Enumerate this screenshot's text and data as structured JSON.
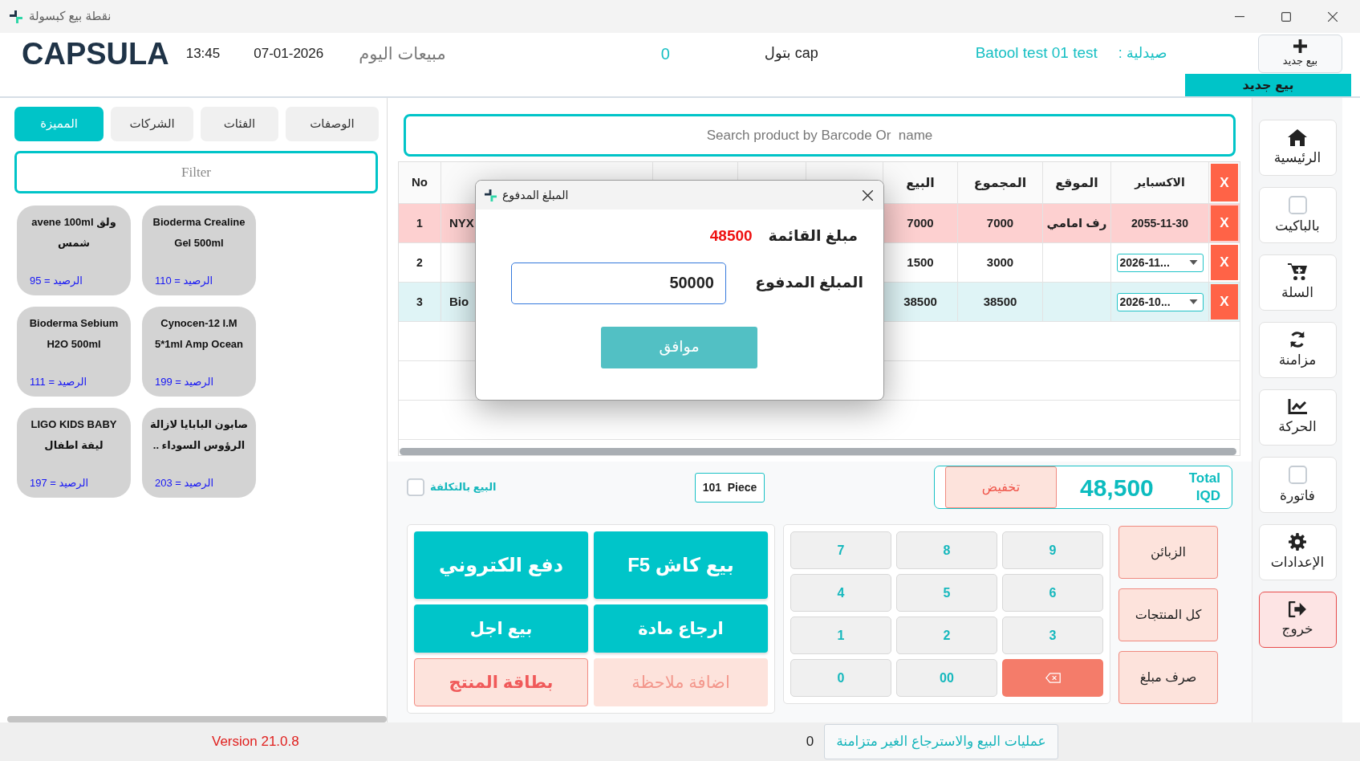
{
  "window": {
    "title": "نقطة بيع كبسولة"
  },
  "header": {
    "logo": "CAPSULA",
    "time": "13:45",
    "date": "07-01-2026",
    "sales_label": "مبيعات اليوم",
    "sales_count": "0",
    "user": "بتول cap",
    "pharmacy_name": "Batool test 01 test",
    "pharmacy_label": "صيدلية :",
    "new_sale_button": "بيع جديد",
    "sale_tab": {
      "label": "بيع جديد",
      "selected": true
    }
  },
  "left_panel": {
    "tabs": [
      {
        "label": "الوصفات",
        "selected": false
      },
      {
        "label": "الفئات",
        "selected": false
      },
      {
        "label": "الشركات",
        "selected": false
      },
      {
        "label": "المميزة",
        "selected": true
      }
    ],
    "filter": {
      "placeholder": "Filter"
    },
    "products": [
      {
        "name": "Bioderma Crealine Gel 500ml",
        "stock": "الرصيد = 110"
      },
      {
        "name": "avene 100ml ولق شمس",
        "stock": "الرصيد = 95"
      },
      {
        "name": "Cynocen-12 I.M 5*1ml Amp Ocean",
        "stock": "الرصيد = 199"
      },
      {
        "name": "Bioderma Sebium H2O 500ml",
        "stock": "الرصيد = 111"
      },
      {
        "name": "صابون البابايا لازالة الرؤوس السوداء ..",
        "stock": "الرصيد = 203"
      },
      {
        "name": "LIGO KIDS BABY ليفة اطفال",
        "stock": "الرصيد = 197"
      }
    ]
  },
  "search": {
    "placeholder": "Search product by Barcode Or  name"
  },
  "table": {
    "columns": {
      "no": "No",
      "sale": "البيع",
      "total": "المجموع",
      "location": "الموقع",
      "expiry": "الاكسباير",
      "delete": "X"
    },
    "rows": [
      {
        "no": "1",
        "name": "NYX",
        "sale": "7000",
        "total": "7000",
        "location": "رف امامي",
        "expiry": {
          "kind": "text",
          "value": "2055-11-30"
        },
        "delete": "X",
        "color": "#fdd0d0"
      },
      {
        "no": "2",
        "sale": "1500",
        "total": "3000",
        "expiry": {
          "kind": "dropdown",
          "value": "2026-11..."
        },
        "delete": "X",
        "color": "#ffffff"
      },
      {
        "no": "3",
        "name": "Bio",
        "sale": "38500",
        "total": "38500",
        "expiry": {
          "kind": "dropdown",
          "value": "2026-10..."
        },
        "delete": "X",
        "color": "#dff4f6"
      }
    ]
  },
  "dialog": {
    "title": "المبلغ المدفوع",
    "list_amount_label": "مبلغ القائمة",
    "list_amount": "48500",
    "paid_label": "المبلغ المدفوع",
    "paid_value": "50000",
    "ok_button": "موافق"
  },
  "cart_summary": {
    "sell_at_cost": {
      "label": "البيع بالتكلفة",
      "checked": false
    },
    "pieces": "101  Piece",
    "discount_button": "تخفيض",
    "amount": "48,500",
    "total_label": "Total",
    "currency": "IQD"
  },
  "actions": [
    {
      "label": "بيع كاش F5",
      "kind": "primary"
    },
    {
      "label": "دفع الكتروني",
      "kind": "primary"
    },
    {
      "label": "ارجاع مادة",
      "kind": "primary"
    },
    {
      "label": "بيع اجل",
      "kind": "primary"
    },
    {
      "label": "اضافة ملاحظة",
      "kind": "soft"
    },
    {
      "label": "بطاقة المنتج",
      "kind": "outline"
    }
  ],
  "keypad": [
    {
      "kind": "digit",
      "label": "9"
    },
    {
      "kind": "digit",
      "label": "8"
    },
    {
      "kind": "digit",
      "label": "7"
    },
    {
      "kind": "digit",
      "label": "6"
    },
    {
      "kind": "digit",
      "label": "5"
    },
    {
      "kind": "digit",
      "label": "4"
    },
    {
      "kind": "digit",
      "label": "3"
    },
    {
      "kind": "digit",
      "label": "2"
    },
    {
      "kind": "digit",
      "label": "1"
    },
    {
      "kind": "backspace"
    },
    {
      "kind": "digit",
      "label": "00"
    },
    {
      "kind": "digit",
      "label": "0"
    }
  ],
  "side_buttons": [
    "الزبائن",
    "كل المنتجات",
    "صرف مبلغ"
  ],
  "sidebar": [
    {
      "label": "الرئيسية",
      "kind": "icon"
    },
    {
      "label": "بالباكيت",
      "kind": "checkbox",
      "checked": false
    },
    {
      "label": "السلة",
      "kind": "icon"
    },
    {
      "label": "مزامنة",
      "kind": "icon"
    },
    {
      "label": "الحركة",
      "kind": "icon"
    },
    {
      "label": "فاتورة",
      "kind": "checkbox",
      "checked": false
    },
    {
      "label": "الإعدادات",
      "kind": "icon"
    },
    {
      "label": "خروج",
      "kind": "exit"
    }
  ],
  "status_bar": {
    "version": "Version 21.0.8",
    "unsynced_count": "0",
    "unsynced_button": "عمليات البيع والاسترجاع الغير متزامنة"
  }
}
